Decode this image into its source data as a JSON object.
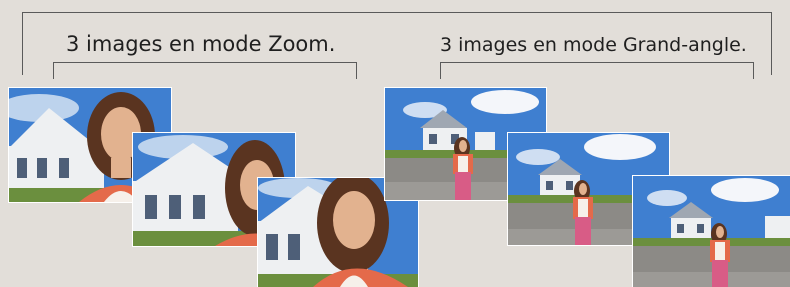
{
  "captions": {
    "zoom": "3 images en mode Zoom.",
    "wide": "3 images en mode Grand-angle."
  },
  "colors": {
    "background": "#e2ded9",
    "sky": "#3f7fd0",
    "cloud": "#f4f6fa",
    "house": "#eef0f2",
    "roof": "#9fa7b2",
    "shutter": "#4e5f78",
    "hair": "#5a3420",
    "skin": "#e2b28f",
    "cardigan": "#e46a4a",
    "top": "#f6f0ea",
    "skirt": "#d85c86",
    "road": "#8c8a86",
    "grass": "#6b8f3e"
  },
  "groups": [
    {
      "name": "zoom",
      "photos": 3
    },
    {
      "name": "wide-angle",
      "photos": 3
    }
  ]
}
